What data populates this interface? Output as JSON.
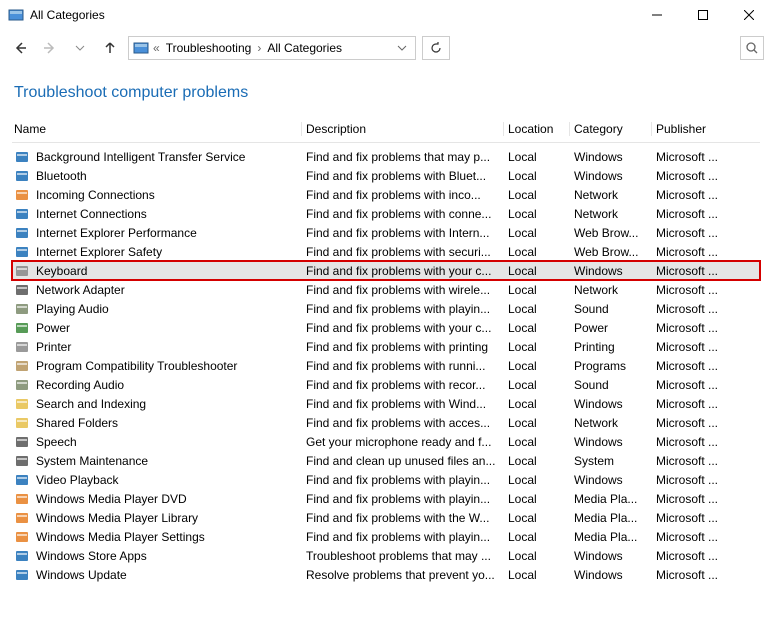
{
  "titlebar": {
    "text": "All Categories"
  },
  "breadcrumb": {
    "root_sep": "«",
    "item1": "Troubleshooting",
    "sep": "›",
    "item2": "All Categories"
  },
  "page_header": "Troubleshoot computer problems",
  "columns": {
    "name": "Name",
    "desc": "Description",
    "loc": "Location",
    "cat": "Category",
    "pub": "Publisher"
  },
  "rows": [
    {
      "name": "Background Intelligent Transfer Service",
      "desc": "Find and fix problems that may p...",
      "loc": "Local",
      "cat": "Windows",
      "pub": "Microsoft ...",
      "icon": "#1a6cb5"
    },
    {
      "name": "Bluetooth",
      "desc": "Find and fix problems with Bluet...",
      "loc": "Local",
      "cat": "Windows",
      "pub": "Microsoft ...",
      "icon": "#1a6cb5"
    },
    {
      "name": "Incoming Connections",
      "desc": "Find and fix problems with inco...",
      "loc": "Local",
      "cat": "Network",
      "pub": "Microsoft ...",
      "icon": "#e67e22"
    },
    {
      "name": "Internet Connections",
      "desc": "Find and fix problems with conne...",
      "loc": "Local",
      "cat": "Network",
      "pub": "Microsoft ...",
      "icon": "#1a6cb5"
    },
    {
      "name": "Internet Explorer Performance",
      "desc": "Find and fix problems with Intern...",
      "loc": "Local",
      "cat": "Web Brow...",
      "pub": "Microsoft ...",
      "icon": "#1a6cb5"
    },
    {
      "name": "Internet Explorer Safety",
      "desc": "Find and fix problems with securi...",
      "loc": "Local",
      "cat": "Web Brow...",
      "pub": "Microsoft ...",
      "icon": "#1a6cb5"
    },
    {
      "name": "Keyboard",
      "desc": "Find and fix problems with your c...",
      "loc": "Local",
      "cat": "Windows",
      "pub": "Microsoft ...",
      "icon": "#888",
      "highlighted": true
    },
    {
      "name": "Network Adapter",
      "desc": "Find and fix problems with wirele...",
      "loc": "Local",
      "cat": "Network",
      "pub": "Microsoft ...",
      "icon": "#555"
    },
    {
      "name": "Playing Audio",
      "desc": "Find and fix problems with playin...",
      "loc": "Local",
      "cat": "Sound",
      "pub": "Microsoft ...",
      "icon": "#7a8a6a"
    },
    {
      "name": "Power",
      "desc": "Find and fix problems with your c...",
      "loc": "Local",
      "cat": "Power",
      "pub": "Microsoft ...",
      "icon": "#3a8a3a"
    },
    {
      "name": "Printer",
      "desc": "Find and fix problems with printing",
      "loc": "Local",
      "cat": "Printing",
      "pub": "Microsoft ...",
      "icon": "#888"
    },
    {
      "name": "Program Compatibility Troubleshooter",
      "desc": "Find and fix problems with runni...",
      "loc": "Local",
      "cat": "Programs",
      "pub": "Microsoft ...",
      "icon": "#b5935a"
    },
    {
      "name": "Recording Audio",
      "desc": "Find and fix problems with recor...",
      "loc": "Local",
      "cat": "Sound",
      "pub": "Microsoft ...",
      "icon": "#7a8a6a"
    },
    {
      "name": "Search and Indexing",
      "desc": "Find and fix problems with Wind...",
      "loc": "Local",
      "cat": "Windows",
      "pub": "Microsoft ...",
      "icon": "#e6c04a"
    },
    {
      "name": "Shared Folders",
      "desc": "Find and fix problems with acces...",
      "loc": "Local",
      "cat": "Network",
      "pub": "Microsoft ...",
      "icon": "#e6c04a"
    },
    {
      "name": "Speech",
      "desc": "Get your microphone ready and f...",
      "loc": "Local",
      "cat": "Windows",
      "pub": "Microsoft ...",
      "icon": "#555"
    },
    {
      "name": "System Maintenance",
      "desc": "Find and clean up unused files an...",
      "loc": "Local",
      "cat": "System",
      "pub": "Microsoft ...",
      "icon": "#555"
    },
    {
      "name": "Video Playback",
      "desc": "Find and fix problems with playin...",
      "loc": "Local",
      "cat": "Windows",
      "pub": "Microsoft ...",
      "icon": "#1a6cb5"
    },
    {
      "name": "Windows Media Player DVD",
      "desc": "Find and fix problems with playin...",
      "loc": "Local",
      "cat": "Media Pla...",
      "pub": "Microsoft ...",
      "icon": "#e67e22"
    },
    {
      "name": "Windows Media Player Library",
      "desc": "Find and fix problems with the W...",
      "loc": "Local",
      "cat": "Media Pla...",
      "pub": "Microsoft ...",
      "icon": "#e67e22"
    },
    {
      "name": "Windows Media Player Settings",
      "desc": "Find and fix problems with playin...",
      "loc": "Local",
      "cat": "Media Pla...",
      "pub": "Microsoft ...",
      "icon": "#e67e22"
    },
    {
      "name": "Windows Store Apps",
      "desc": "Troubleshoot problems that may ...",
      "loc": "Local",
      "cat": "Windows",
      "pub": "Microsoft ...",
      "icon": "#1a6cb5"
    },
    {
      "name": "Windows Update",
      "desc": "Resolve problems that prevent yo...",
      "loc": "Local",
      "cat": "Windows",
      "pub": "Microsoft ...",
      "icon": "#1a6cb5"
    }
  ]
}
